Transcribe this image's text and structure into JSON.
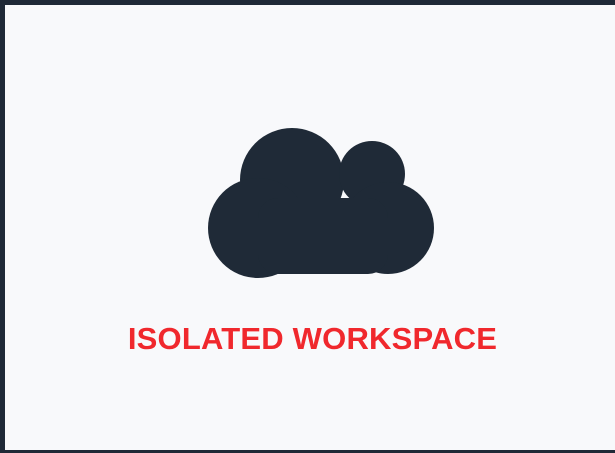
{
  "workspace": {
    "status_text": "ISOLATED WORKSPACE",
    "icon": "cloud-icon"
  },
  "colors": {
    "frame_border": "#1f2937",
    "background": "#f8f9fb",
    "icon": "#1f2a37",
    "status_text": "#f0282d"
  }
}
